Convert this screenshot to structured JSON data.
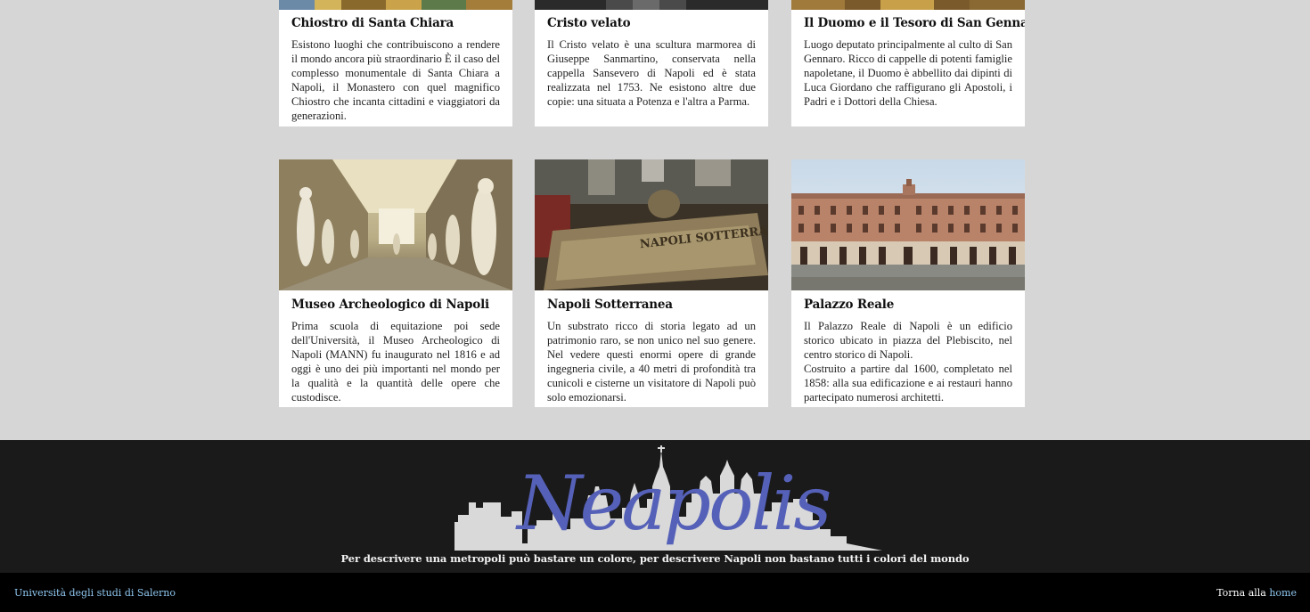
{
  "cards_row1": [
    {
      "title": "Chiostro di Santa Chiara",
      "text": "Esistono luoghi che contribuiscono a rendere il mondo ancora più straordinario È il caso del complesso monumentale di Santa Chiara a Napoli, il Monastero con quel magnifico Chiostro che incanta cittadini e viaggiatori da generazioni."
    },
    {
      "title": "Cristo velato",
      "text": "Il Cristo velato è una scultura marmorea di Giuseppe Sanmartino, conservata nella cappella Sansevero di Napoli ed è stata realizzata nel 1753. Ne esistono altre due copie: una situata a Potenza e l'altra a Parma."
    },
    {
      "title": "Il Duomo e il Tesoro di San Gennaro",
      "text": "Luogo deputato principalmente al culto di San Gennaro. Ricco di cappelle di potenti famiglie napoletane, il Duomo è abbellito dai dipinti di Luca Giordano che raffigurano gli Apostoli, i Padri e i Dottori della Chiesa."
    }
  ],
  "cards_row2": [
    {
      "title": "Museo Archeologico di Napoli",
      "text": "Prima scuola di equitazione poi sede dell'Università, il Museo Archeologico di Napoli (MANN) fu inaugurato nel 1816 e ad oggi è uno dei più importanti nel mondo per la qualità e la quantità delle opere che custodisce."
    },
    {
      "title": "Napoli Sotterranea",
      "text": "Un substrato ricco di storia legato ad un patrimonio raro, se non unico nel suo genere. Nel vedere questi enormi opere di grande ingegneria civile, a 40 metri di profondità tra cunicoli e cisterne un visitatore di Napoli può solo emozionarsi."
    },
    {
      "title": "Palazzo Reale",
      "text": "Il Palazzo Reale di Napoli è un edificio storico ubicato in piazza del Plebiscito, nel centro storico di Napoli.",
      "text2": "Costruito a partire dal 1600, completato nel 1858: alla sua edificazione e ai restauri hanno partecipato numerosi architetti."
    }
  ],
  "footer": {
    "logo_text": "Neapolis",
    "sign_text": "NAPOLI SOTTERRANEA",
    "tagline": "Per descrivere una metropoli può bastare un colore, per descrivere Napoli non bastano tutti i colori del mondo",
    "university_link": "Università degli studi di Salerno",
    "back_prefix": "Torna alla",
    "home_link": "home"
  },
  "colors": {
    "page_bg": "#d6d6d6",
    "footer_bg": "#1a1a1a",
    "bar_bg": "#000000",
    "link": "#8fc6ef",
    "logo": "#5561b8",
    "skyline": "#d9d9d9"
  }
}
